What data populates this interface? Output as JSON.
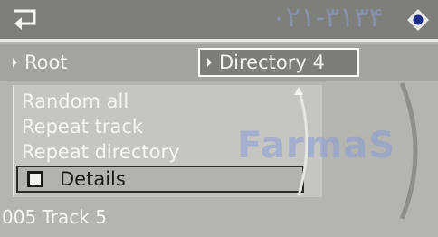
{
  "header": {
    "back_icon": "back-arrow-icon",
    "watermark_text": "۰۲۱-۳۱۳۴",
    "nav_icon": "navigation-dial-icon"
  },
  "tabs": {
    "root_label": "Root",
    "directory_label": "Directory  4"
  },
  "menu": {
    "items": [
      "Random all",
      "Repeat track",
      "Repeat directory"
    ],
    "details_label": "Details"
  },
  "status": {
    "track": "005 Track 5"
  },
  "watermark": {
    "text": "FarmaS"
  },
  "colors": {
    "topbar": "#7e7f7b",
    "selected_tab": "#7d7e7a",
    "menu_bg": "#c5c6c2",
    "text": "#f5f5f3"
  }
}
